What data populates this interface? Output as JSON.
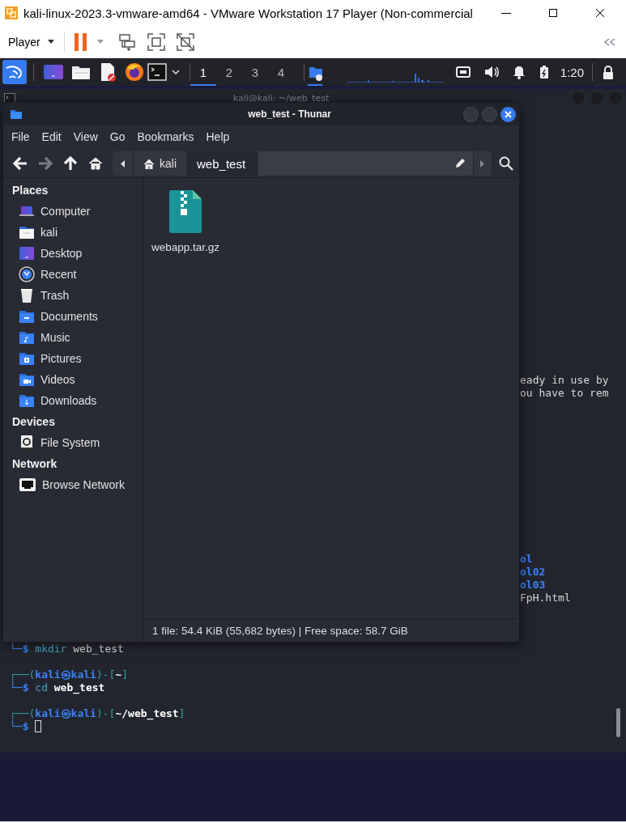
{
  "vmware": {
    "title": "kali-linux-2023.3-vmware-amd64 - VMware Workstation 17 Player (Non-commercial",
    "menu": "Player"
  },
  "panel": {
    "workspaces": [
      {
        "label": "1",
        "selected": true
      },
      {
        "label": "2",
        "selected": false
      },
      {
        "label": "3",
        "selected": false
      },
      {
        "label": "4",
        "selected": false
      }
    ],
    "clock": "1:20"
  },
  "terminal": {
    "title": "kali@kali: ~/web_test",
    "message_lines": [
      "eady in use by",
      "ou have to rem"
    ],
    "listing": [
      {
        "text": "ol",
        "kind": "dir"
      },
      {
        "text": "ol02",
        "kind": "dir"
      },
      {
        "text": "ol03",
        "kind": "dir"
      },
      {
        "text": "FpH.html",
        "kind": "file"
      }
    ],
    "history": [
      {
        "lines": [
          {
            "kind": "command",
            "symbol": "└─$",
            "command": "mkdir",
            "argument": "web_test",
            "argument_exists": false
          }
        ]
      },
      {
        "lines": [
          {
            "kind": "prompt",
            "open": "┌──(",
            "user": "kali㉿kali",
            "middle": ")-[",
            "path": "~",
            "close": "]"
          },
          {
            "kind": "command",
            "symbol": "└─$",
            "command": "cd",
            "argument": "web_test",
            "argument_exists": true
          }
        ]
      },
      {
        "lines": [
          {
            "kind": "prompt",
            "open": "┌──(",
            "user": "kali㉿kali",
            "middle": ")-[",
            "path": "~/web_test",
            "close": "]"
          },
          {
            "kind": "input",
            "symbol": "└─$"
          }
        ]
      }
    ]
  },
  "thunar": {
    "title": "web_test - Thunar",
    "menu": [
      "File",
      "Edit",
      "View",
      "Go",
      "Bookmarks",
      "Help"
    ],
    "toolbar": [
      {
        "kind": "back",
        "disabled": false
      },
      {
        "kind": "forward",
        "disabled": true
      },
      {
        "kind": "up",
        "disabled": false
      },
      {
        "kind": "home",
        "disabled": false
      }
    ],
    "path": [
      {
        "label": "kali",
        "kind": "home",
        "selected": false
      },
      {
        "label": "web_test",
        "kind": "folder",
        "selected": true
      }
    ],
    "sidebar": [
      {
        "title": "Places",
        "items": [
          {
            "label": "Computer",
            "kind": "computer"
          },
          {
            "label": "kali",
            "kind": "home"
          },
          {
            "label": "Desktop",
            "kind": "desktop"
          },
          {
            "label": "Recent",
            "kind": "recent"
          },
          {
            "label": "Trash",
            "kind": "trash"
          },
          {
            "label": "Documents",
            "kind": "documents"
          },
          {
            "label": "Music",
            "kind": "music"
          },
          {
            "label": "Pictures",
            "kind": "pictures"
          },
          {
            "label": "Videos",
            "kind": "videos"
          },
          {
            "label": "Downloads",
            "kind": "downloads"
          }
        ]
      },
      {
        "title": "Devices",
        "items": [
          {
            "label": "File System",
            "kind": "drive"
          }
        ]
      },
      {
        "title": "Network",
        "items": [
          {
            "label": "Browse Network",
            "kind": "network"
          }
        ]
      }
    ],
    "files": [
      {
        "name": "webapp.tar.gz",
        "kind": "archive"
      }
    ],
    "status": "1 file: 54.4 KiB (55,682 bytes) | Free space: 58.7 GiB"
  }
}
